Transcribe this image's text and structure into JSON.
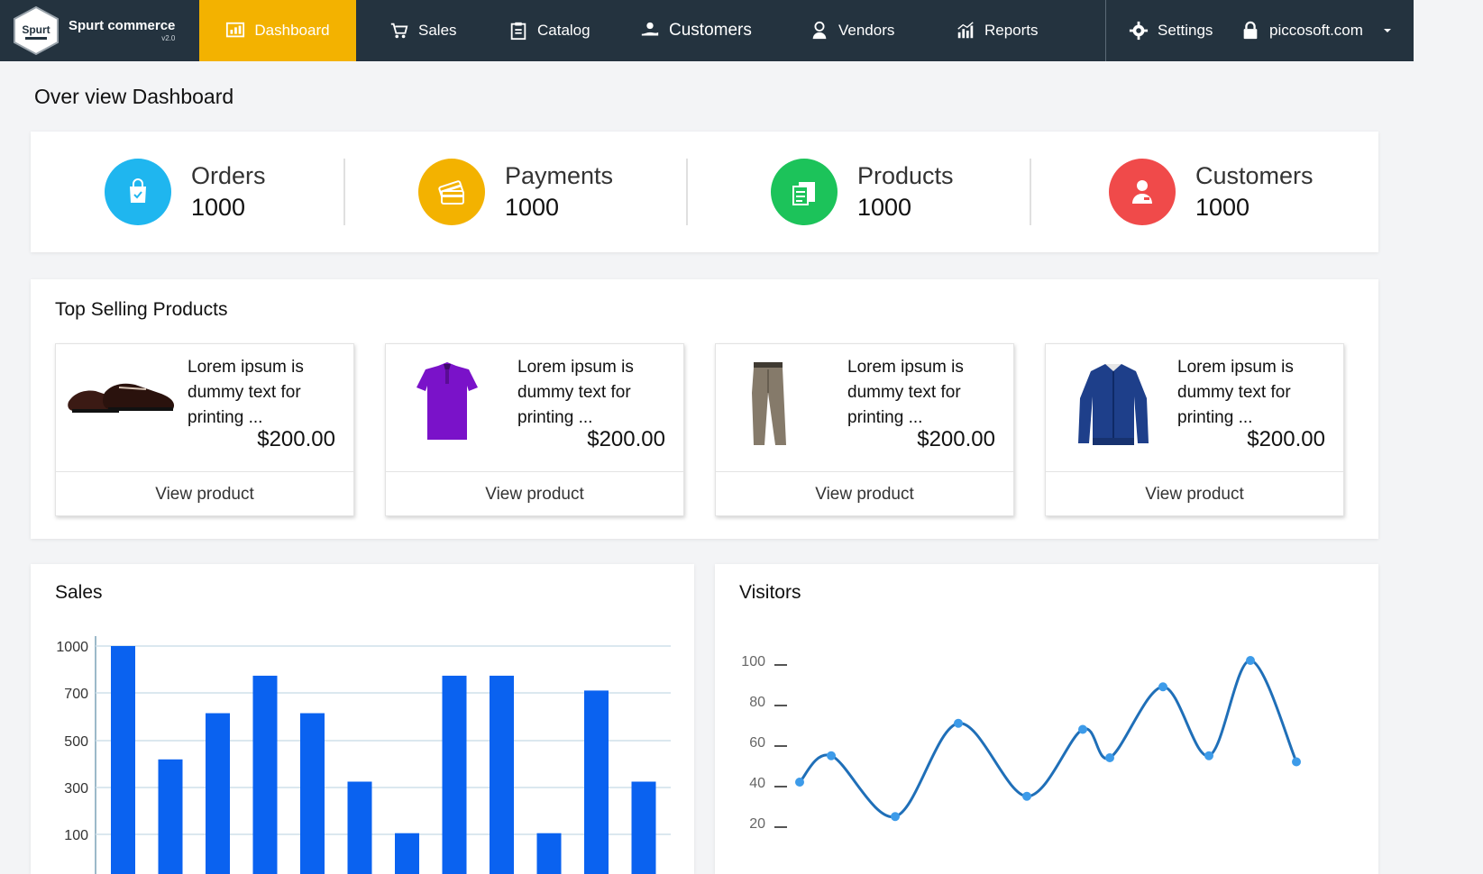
{
  "brand": {
    "name": "Spurt commerce",
    "badge_text": "Spurt",
    "version": "v2.0"
  },
  "nav": {
    "dashboard": "Dashboard",
    "sales": "Sales",
    "catalog": "Catalog",
    "customers": "Customers",
    "vendors": "Vendors",
    "reports": "Reports",
    "settings": "Settings",
    "account": "piccosoft.com"
  },
  "page": {
    "title": "Over view Dashboard"
  },
  "stats": [
    {
      "label": "Orders",
      "value": "1000",
      "color": "#1fb6ef",
      "icon": "shopping-bag-icon"
    },
    {
      "label": "Payments",
      "value": "1000",
      "color": "#f3b200",
      "icon": "credit-cards-icon"
    },
    {
      "label": "Products",
      "value": "1000",
      "color": "#1cc35a",
      "icon": "products-box-icon"
    },
    {
      "label": "Customers",
      "value": "1000",
      "color": "#f04a4a",
      "icon": "customer-user-icon"
    }
  ],
  "top_selling": {
    "title": "Top Selling Products",
    "products": [
      {
        "name": "Lorem ipsum is dummy text for printing ...",
        "price": "$200.00",
        "action": "View product",
        "image": "shoes"
      },
      {
        "name": "Lorem ipsum is dummy text for printing ...",
        "price": "$200.00",
        "action": "View product",
        "image": "polo-shirt"
      },
      {
        "name": "Lorem ipsum is dummy text for printing ...",
        "price": "$200.00",
        "action": "View product",
        "image": "trousers"
      },
      {
        "name": "Lorem ipsum is dummy text for printing ...",
        "price": "$200.00",
        "action": "View product",
        "image": "jacket"
      }
    ]
  },
  "sales_chart": {
    "title": "Sales"
  },
  "visitors_chart": {
    "title": "Visitors"
  },
  "chart_data": [
    {
      "type": "bar",
      "title": "Sales",
      "yticks": [
        1000,
        700,
        500,
        300,
        100
      ],
      "values": [
        1000,
        420,
        615,
        810,
        615,
        325,
        105,
        810,
        810,
        105,
        715,
        325
      ],
      "color": "#0a62f0",
      "grid": true
    },
    {
      "type": "line",
      "title": "Visitors",
      "yticks": [
        100,
        80,
        60,
        40,
        20
      ],
      "values": [
        40,
        53,
        23,
        69,
        33,
        66,
        52,
        87,
        53,
        100,
        50
      ],
      "color": "#1f6fb8",
      "marker_color": "#3d9be9",
      "smooth": true
    }
  ]
}
